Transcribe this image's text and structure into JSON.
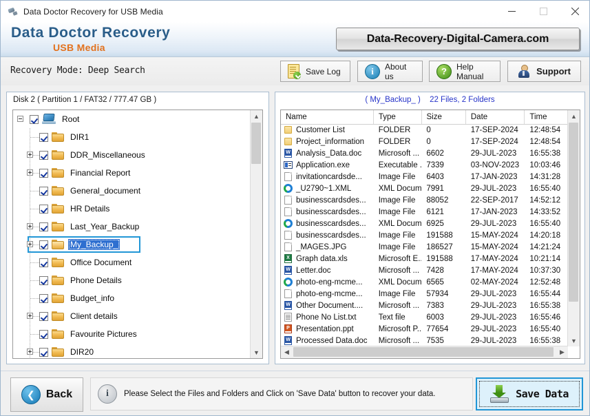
{
  "window": {
    "title": "Data Doctor Recovery for USB Media",
    "app_icon": "usb-drive-icon",
    "controls": {
      "minimize": "minimize-icon",
      "maximize": "maximize-icon",
      "close": "close-icon"
    }
  },
  "brand": {
    "main": "Data Doctor Recovery",
    "sub": "USB Media",
    "site_button": "Data-Recovery-Digital-Camera.com"
  },
  "toolbar": {
    "recovery_mode": "Recovery Mode: Deep Search",
    "buttons": [
      {
        "label": "Save Log",
        "icon": "save-log-icon"
      },
      {
        "label": "About us",
        "icon": "info-icon"
      },
      {
        "label": "Help Manual",
        "icon": "question-icon"
      },
      {
        "label": "Support",
        "icon": "support-person-icon"
      }
    ]
  },
  "left_panel": {
    "disk_info": "Disk 2 ( Partition 1 / FAT32 / 777.47 GB )",
    "tree": [
      {
        "label": "Root",
        "icon": "computer-icon",
        "checked": true,
        "expander": "minus",
        "level": 0,
        "selected": false
      },
      {
        "label": "DIR1",
        "icon": "folder-icon",
        "checked": true,
        "expander": "none",
        "level": 1,
        "selected": false
      },
      {
        "label": "DDR_Miscellaneous",
        "icon": "folder-icon",
        "checked": true,
        "expander": "plus",
        "level": 1,
        "selected": false
      },
      {
        "label": "Financial Report",
        "icon": "folder-icon",
        "checked": true,
        "expander": "plus",
        "level": 1,
        "selected": false
      },
      {
        "label": "General_document",
        "icon": "folder-icon",
        "checked": true,
        "expander": "none",
        "level": 1,
        "selected": false
      },
      {
        "label": "HR Details",
        "icon": "folder-icon",
        "checked": true,
        "expander": "none",
        "level": 1,
        "selected": false
      },
      {
        "label": "Last_Year_Backup",
        "icon": "folder-icon",
        "checked": true,
        "expander": "plus",
        "level": 1,
        "selected": false
      },
      {
        "label": "My_Backup_",
        "icon": "folder-open-icon",
        "checked": true,
        "expander": "plus",
        "level": 1,
        "selected": true
      },
      {
        "label": "Office Document",
        "icon": "folder-icon",
        "checked": true,
        "expander": "none",
        "level": 1,
        "selected": false
      },
      {
        "label": "Phone Details",
        "icon": "folder-icon",
        "checked": true,
        "expander": "none",
        "level": 1,
        "selected": false
      },
      {
        "label": "Budget_info",
        "icon": "folder-icon",
        "checked": true,
        "expander": "none",
        "level": 1,
        "selected": false
      },
      {
        "label": "Client details",
        "icon": "folder-icon",
        "checked": true,
        "expander": "plus",
        "level": 1,
        "selected": false
      },
      {
        "label": "Favourite Pictures",
        "icon": "folder-icon",
        "checked": true,
        "expander": "none",
        "level": 1,
        "selected": false
      },
      {
        "label": "DIR20",
        "icon": "folder-icon",
        "checked": true,
        "expander": "plus",
        "level": 1,
        "selected": false
      }
    ]
  },
  "right_panel": {
    "current_folder": "( My_Backup_ )",
    "counts": "22 Files, 2 Folders",
    "columns": [
      "Name",
      "Type",
      "Size",
      "Date",
      "Time"
    ],
    "rows": [
      {
        "icon": "folder-icon",
        "name": "Customer List",
        "type": "FOLDER",
        "size": "0",
        "date": "17-SEP-2024",
        "time": "12:48:54"
      },
      {
        "icon": "folder-icon",
        "name": "Project_information",
        "type": "FOLDER",
        "size": "0",
        "date": "17-SEP-2024",
        "time": "12:48:54"
      },
      {
        "icon": "word-doc-icon",
        "name": "Analysis_Data.doc",
        "type": "Microsoft ...",
        "size": "6602",
        "date": "29-JUL-2023",
        "time": "16:55:38"
      },
      {
        "icon": "exe-icon",
        "name": "Application.exe",
        "type": "Executable ...",
        "size": "7339",
        "date": "03-NOV-2023",
        "time": "10:03:46"
      },
      {
        "icon": "blank-file-icon",
        "name": "invitationcardsde...",
        "type": "Image File",
        "size": "6403",
        "date": "17-JAN-2023",
        "time": "14:31:28"
      },
      {
        "icon": "xml-icon",
        "name": "_U2790~1.XML",
        "type": "XML Docum...",
        "size": "7991",
        "date": "29-JUL-2023",
        "time": "16:55:40"
      },
      {
        "icon": "blank-file-icon",
        "name": "businesscardsdes...",
        "type": "Image File",
        "size": "88052",
        "date": "22-SEP-2017",
        "time": "14:52:12"
      },
      {
        "icon": "blank-file-icon",
        "name": "businesscardsdes...",
        "type": "Image File",
        "size": "6121",
        "date": "17-JAN-2023",
        "time": "14:33:52"
      },
      {
        "icon": "xml-icon",
        "name": "businesscardsdes...",
        "type": "XML Docum...",
        "size": "6925",
        "date": "29-JUL-2023",
        "time": "16:55:40"
      },
      {
        "icon": "blank-file-icon",
        "name": "businesscardsdes...",
        "type": "Image File",
        "size": "191588",
        "date": "15-MAY-2024",
        "time": "14:20:18"
      },
      {
        "icon": "blank-file-icon",
        "name": "_MAGES.JPG",
        "type": "Image File",
        "size": "186527",
        "date": "15-MAY-2024",
        "time": "14:21:24"
      },
      {
        "icon": "excel-icon",
        "name": "Graph data.xls",
        "type": "Microsoft E...",
        "size": "191588",
        "date": "17-MAY-2024",
        "time": "10:21:14"
      },
      {
        "icon": "word-doc-icon",
        "name": "Letter.doc",
        "type": "Microsoft ...",
        "size": "7428",
        "date": "17-MAY-2024",
        "time": "10:37:30"
      },
      {
        "icon": "xml-icon",
        "name": "photo-eng-mcme...",
        "type": "XML Docum...",
        "size": "6565",
        "date": "02-MAY-2024",
        "time": "12:52:48"
      },
      {
        "icon": "blank-file-icon",
        "name": "photo-eng-mcme...",
        "type": "Image File",
        "size": "57934",
        "date": "29-JUL-2023",
        "time": "16:55:44"
      },
      {
        "icon": "word-doc-icon",
        "name": "Other Document....",
        "type": "Microsoft ...",
        "size": "7383",
        "date": "29-JUL-2023",
        "time": "16:55:38"
      },
      {
        "icon": "text-file-icon",
        "name": "Phone No List.txt",
        "type": "Text file",
        "size": "6003",
        "date": "29-JUL-2023",
        "time": "16:55:46"
      },
      {
        "icon": "powerpoint-icon",
        "name": "Presentation.ppt",
        "type": "Microsoft P...",
        "size": "77654",
        "date": "29-JUL-2023",
        "time": "16:55:40"
      },
      {
        "icon": "word-doc-icon",
        "name": "Processed Data.doc",
        "type": "Microsoft ...",
        "size": "7535",
        "date": "29-JUL-2023",
        "time": "16:55:38"
      }
    ]
  },
  "footer": {
    "back_label": "Back",
    "message": "Please Select the Files and Folders and Click on 'Save Data' button to recover your data.",
    "save_label": "Save  Data"
  },
  "colors": {
    "brand_blue": "#2a5d89",
    "brand_orange": "#e2711d",
    "accent_highlight": "#2196d6",
    "selection_blue": "#2e6fd0",
    "link_blue": "#2734c9"
  }
}
